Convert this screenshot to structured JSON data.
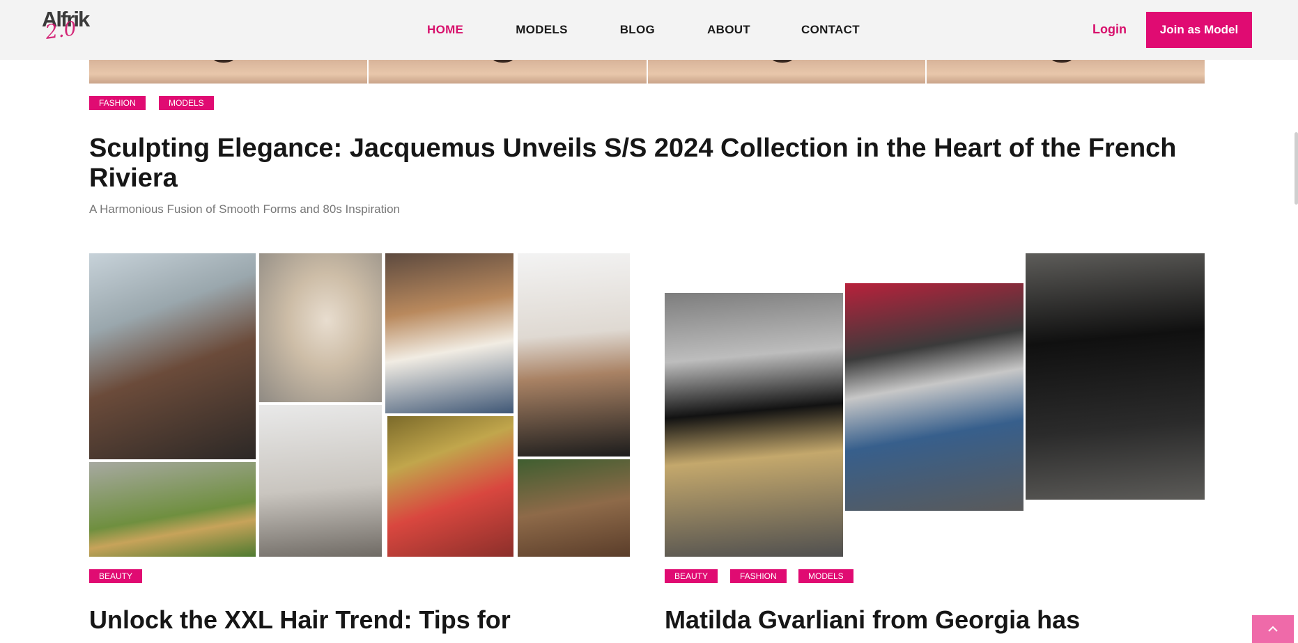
{
  "header": {
    "logo_text": "Alfrik",
    "logo_script": "2.0",
    "nav": [
      {
        "label": "HOME",
        "active": true
      },
      {
        "label": "MODELS",
        "active": false
      },
      {
        "label": "BLOG",
        "active": false
      },
      {
        "label": "ABOUT",
        "active": false
      },
      {
        "label": "CONTACT",
        "active": false
      }
    ],
    "login_label": "Login",
    "join_label": "Join as Model"
  },
  "featured": {
    "tags": [
      "FASHION",
      "MODELS"
    ],
    "title": "Sculpting Elegance: Jacquemus Unveils S/S 2024 Collection in the Heart of the French Riviera",
    "subtitle": "A Harmonious Fusion of Smooth Forms and 80s Inspiration"
  },
  "cards": [
    {
      "tags": [
        "BEAUTY"
      ],
      "title": "Unlock the XXL Hair Trend: Tips for"
    },
    {
      "tags": [
        "BEAUTY",
        "FASHION",
        "MODELS"
      ],
      "title": "Matilda Gvarliani from Georgia has"
    }
  ],
  "colors": {
    "accent": "#e00b72",
    "header_bg": "#f3f3f3"
  },
  "icons": {
    "back_to_top": "chevron-up-icon"
  }
}
